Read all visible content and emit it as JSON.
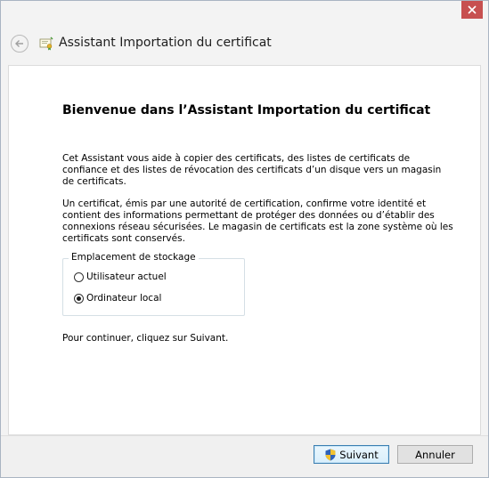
{
  "window": {
    "close_label": "×"
  },
  "header": {
    "title": "Assistant Importation du certificat"
  },
  "main": {
    "heading": "Bienvenue dans l’Assistant Importation du certificat",
    "intro": "Cet Assistant vous aide à copier des certificats, des listes de certificats de confiance et des listes de révocation des certificats d’un disque vers un magasin de certificats.",
    "description": "Un certificat, émis par une autorité de certification, confirme votre identité et contient des informations permettant de protéger des données ou d’établir des connexions réseau sécurisées. Le magasin de certificats est la zone système où les certificats sont conservés.",
    "storage": {
      "legend": "Emplacement de stockage",
      "options": [
        {
          "label": "Utilisateur actuel",
          "checked": false
        },
        {
          "label": "Ordinateur local",
          "checked": true
        }
      ]
    },
    "continue_text": "Pour continuer, cliquez sur Suivant."
  },
  "footer": {
    "next_label": "Suivant",
    "cancel_label": "Annuler"
  },
  "icons": {
    "back": "back-arrow-icon",
    "certificate": "certificate-icon",
    "shield": "uac-shield-icon",
    "close": "close-icon"
  },
  "colors": {
    "close_button": "#c75050",
    "primary_button_border": "#3c7fb1"
  }
}
